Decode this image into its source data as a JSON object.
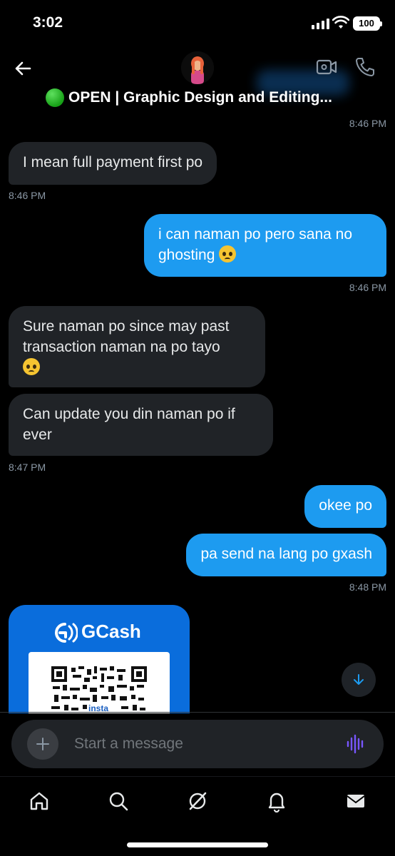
{
  "status_bar": {
    "time": "3:02",
    "battery": "100"
  },
  "header": {
    "title": "OPEN | Graphic Design and Editing...",
    "status_emoji": "green-circle",
    "icons": [
      "back-arrow-icon",
      "video-call-icon",
      "phone-call-icon"
    ]
  },
  "messages": [
    {
      "type": "timestamp",
      "align": "right",
      "text": "8:46 PM"
    },
    {
      "type": "bubble",
      "side": "in",
      "text": "I mean full payment first po"
    },
    {
      "type": "timestamp",
      "align": "left",
      "text": "8:46 PM"
    },
    {
      "type": "bubble",
      "side": "out",
      "lines": [
        "i can naman po pero sana no",
        "ghosting"
      ],
      "emoji": "pleading-face"
    },
    {
      "type": "timestamp",
      "align": "right",
      "text": "8:46 PM"
    },
    {
      "type": "bubble",
      "side": "in",
      "lines": [
        "Sure naman po since may past",
        "transaction naman na po tayo"
      ],
      "emoji": "pleading-face"
    },
    {
      "type": "bubble",
      "side": "in",
      "lines": [
        "Can update you din naman po if",
        "ever"
      ]
    },
    {
      "type": "timestamp",
      "align": "left",
      "text": "8:47 PM"
    },
    {
      "type": "bubble",
      "side": "out",
      "text": "okee po"
    },
    {
      "type": "bubble",
      "side": "out",
      "text": "pa send na lang po gxash"
    },
    {
      "type": "timestamp",
      "align": "right",
      "text": "8:48 PM"
    }
  ],
  "attachment": {
    "brand": "GCash",
    "qr_label": "insta"
  },
  "composer": {
    "placeholder": "Start a message"
  },
  "colors": {
    "background": "#000000",
    "bubble_out": "#1d9bf0",
    "bubble_in": "#202327",
    "timestamp": "#8b98a5",
    "gcash_blue": "#0a6ddc",
    "voice_accent": "#7856ff"
  },
  "tab_bar": {
    "items": [
      "home-icon",
      "search-icon",
      "grok-icon",
      "notifications-icon",
      "messages-icon"
    ]
  }
}
